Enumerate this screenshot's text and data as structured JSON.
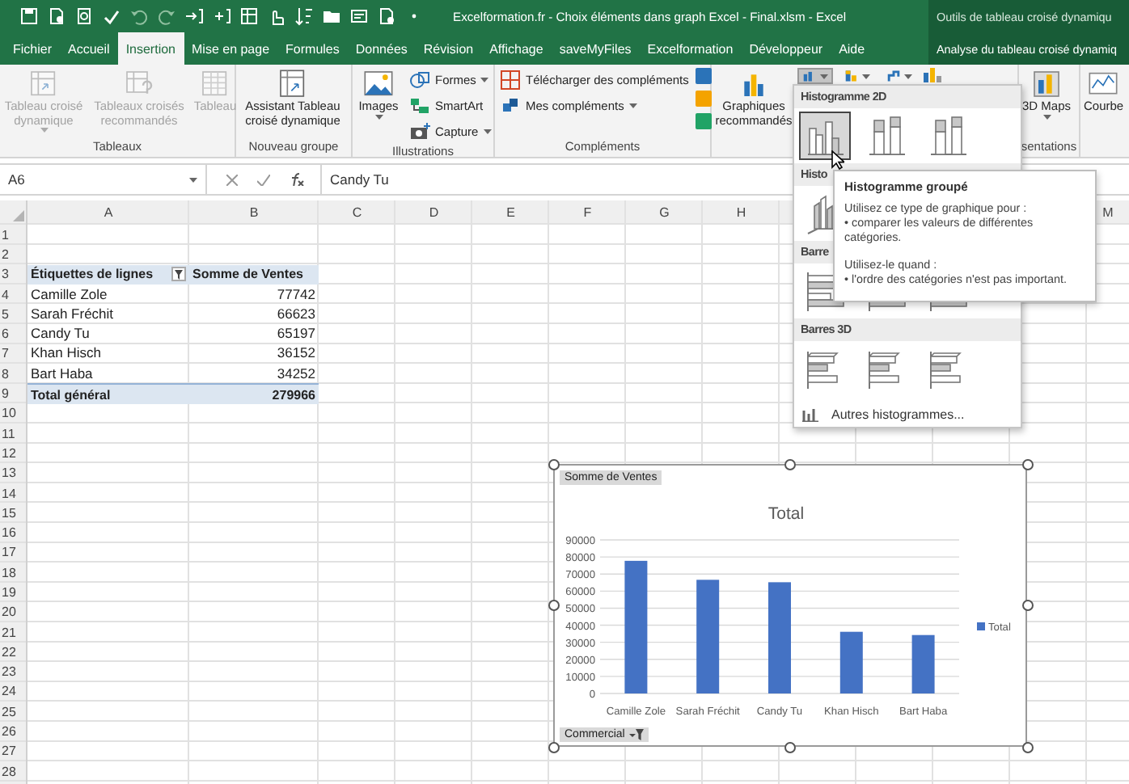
{
  "window": {
    "title": "Excelformation.fr - Choix éléments dans graph Excel - Final.xlsm  -  Excel",
    "context_title": "Outils de tableau croisé dynamiqu"
  },
  "tabs": [
    {
      "label": "Fichier",
      "selected": false,
      "kind": "main"
    },
    {
      "label": "Accueil",
      "selected": false,
      "kind": "main"
    },
    {
      "label": "Insertion",
      "selected": true,
      "kind": "main"
    },
    {
      "label": "Mise en page",
      "selected": false,
      "kind": "main"
    },
    {
      "label": "Formules",
      "selected": false,
      "kind": "main"
    },
    {
      "label": "Données",
      "selected": false,
      "kind": "main"
    },
    {
      "label": "Révision",
      "selected": false,
      "kind": "main"
    },
    {
      "label": "Affichage",
      "selected": false,
      "kind": "main"
    },
    {
      "label": "saveMyFiles",
      "selected": false,
      "kind": "main"
    },
    {
      "label": "Excelformation",
      "selected": false,
      "kind": "main"
    },
    {
      "label": "Développeur",
      "selected": false,
      "kind": "main"
    },
    {
      "label": "Aide",
      "selected": false,
      "kind": "main"
    },
    {
      "label": "Analyse du tableau croisé dynamiq",
      "selected": false,
      "kind": "context"
    }
  ],
  "ribbon": {
    "groups": [
      {
        "label": "Tableaux",
        "items": [
          {
            "kind": "big",
            "label": "Tableau croisé dynamique",
            "dropdown": true,
            "disabled": true
          },
          {
            "kind": "big",
            "label": "Tableaux croisés recommandés",
            "dropdown": false,
            "disabled": true
          },
          {
            "kind": "big",
            "label": "Tableau",
            "dropdown": false,
            "disabled": true
          }
        ]
      },
      {
        "label": "Nouveau groupe",
        "items": [
          {
            "kind": "big",
            "label": "Assistant Tableau croisé dynamique",
            "dropdown": false,
            "disabled": false
          }
        ]
      },
      {
        "label": "Illustrations",
        "items": [
          {
            "kind": "big",
            "label": "Images",
            "dropdown": true,
            "disabled": false
          },
          {
            "kind": "small",
            "label": "Formes",
            "dropdown": true,
            "disabled": false
          },
          {
            "kind": "small",
            "label": "SmartArt",
            "dropdown": false,
            "disabled": false
          },
          {
            "kind": "small",
            "label": "Capture",
            "dropdown": true,
            "disabled": false
          }
        ]
      },
      {
        "label": "Compléments",
        "items": [
          {
            "kind": "small",
            "label": "Télécharger des compléments",
            "dropdown": false,
            "disabled": false
          },
          {
            "kind": "small",
            "label": "Mes compléments",
            "dropdown": true,
            "disabled": false
          }
        ]
      },
      {
        "items": [
          {
            "kind": "big",
            "label": "Graphiques recommandés",
            "dropdown": false,
            "disabled": false
          },
          {
            "kind": "chart",
            "expanded": true,
            "dropdown": true,
            "disabled": false
          },
          {
            "kind": "chart",
            "expanded": false,
            "dropdown": true,
            "disabled": false
          },
          {
            "kind": "chart",
            "expanded": false,
            "dropdown": true,
            "disabled": false
          }
        ]
      },
      {
        "label": "sentations",
        "items": [
          {
            "kind": "big",
            "label": "3D Maps",
            "dropdown": true,
            "disabled": false
          }
        ]
      },
      {
        "items": [
          {
            "kind": "big",
            "label": "Courbe",
            "dropdown": false,
            "disabled": false
          }
        ]
      }
    ]
  },
  "formula_bar": {
    "name_box": "A6",
    "value": "Candy Tu"
  },
  "sheet": {
    "column_headers": [
      "A",
      "B",
      "C",
      "D",
      "E",
      "F",
      "G",
      "H",
      "M"
    ],
    "row_numbers": [
      "1",
      "2",
      "3",
      "4",
      "5",
      "6",
      "7",
      "8",
      "9",
      "10",
      "11",
      "12",
      "13",
      "14",
      "15",
      "16",
      "17",
      "18",
      "19",
      "20",
      "21",
      "22",
      "23",
      "24",
      "25",
      "26",
      "27",
      "28"
    ],
    "pivot": {
      "headers": [
        "Étiquettes de lignes",
        "Somme de Ventes"
      ],
      "rows": [
        {
          "label": "Camille Zole",
          "value": "77742"
        },
        {
          "label": "Sarah Fréchit",
          "value": "66623"
        },
        {
          "label": "Candy Tu",
          "value": "65197"
        },
        {
          "label": "Khan Hisch",
          "value": "36152"
        },
        {
          "label": "Bart Haba",
          "value": "34252"
        }
      ],
      "total": {
        "label": "Total général",
        "value": "279966"
      }
    }
  },
  "chart": {
    "value_field": "Somme de Ventes",
    "axis_field": "Commercial",
    "chart_data": {
      "type": "bar",
      "title": "Total",
      "categories": [
        "Camille Zole",
        "Sarah Fréchit",
        "Candy Tu",
        "Khan Hisch",
        "Bart Haba"
      ],
      "series": [
        {
          "name": "Total",
          "color": "#4472c4",
          "values": [
            77742,
            66623,
            65197,
            36152,
            34252
          ]
        }
      ],
      "grid": true,
      "ylim": [
        0,
        90000
      ],
      "yticks": [
        0,
        10000,
        20000,
        30000,
        40000,
        50000,
        60000,
        70000,
        80000,
        90000
      ]
    }
  },
  "chart_menu": {
    "sections": [
      {
        "title": "Histogramme 2D",
        "options": [
          {
            "selected": true
          },
          {
            "selected": false
          },
          {
            "selected": false
          }
        ]
      },
      {
        "title": "Histo",
        "options": [
          {
            "selected": false
          }
        ]
      },
      {
        "title": "Barre",
        "options": [
          {
            "selected": false
          },
          {
            "selected": false
          },
          {
            "selected": false
          }
        ]
      },
      {
        "title": "Barres 3D",
        "options": [
          {
            "selected": false
          },
          {
            "selected": false
          },
          {
            "selected": false
          }
        ]
      }
    ],
    "more": "Autres histogrammes..."
  },
  "tooltip": {
    "title": "Histogramme groupé",
    "paragraphs": [
      {
        "lines": [
          "Utilisez ce type de graphique pour :",
          "• comparer les valeurs de différentes catégories."
        ]
      },
      {
        "lines": [
          "Utilisez-le quand :",
          "• l'ordre des catégories n'est pas important."
        ]
      }
    ]
  }
}
